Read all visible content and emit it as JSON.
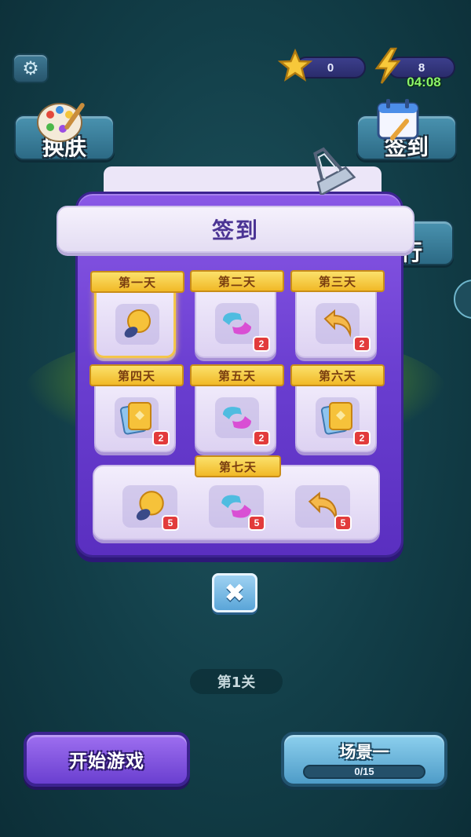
{
  "hud": {
    "stars": "0",
    "energy": "8",
    "timer": "04:08",
    "settings_icon": "gear-icon"
  },
  "side_buttons": {
    "skin": "换肤",
    "signin": "签到",
    "rank_partial": "行"
  },
  "signin_modal": {
    "title": "签到",
    "days": [
      {
        "label": "第一天",
        "reward_icon": "lightbulb-icon",
        "qty": "",
        "current": true
      },
      {
        "label": "第二天",
        "reward_icon": "swap-shapes-icon",
        "qty": "2"
      },
      {
        "label": "第三天",
        "reward_icon": "undo-arrow-icon",
        "qty": "2"
      },
      {
        "label": "第四天",
        "reward_icon": "card-icon",
        "qty": "2"
      },
      {
        "label": "第五天",
        "reward_icon": "swap-shapes-icon",
        "qty": "2"
      },
      {
        "label": "第六天",
        "reward_icon": "card-icon",
        "qty": "2"
      }
    ],
    "day7": {
      "label": "第七天",
      "rewards": [
        {
          "icon": "lightbulb-icon",
          "qty": "5"
        },
        {
          "icon": "swap-shapes-icon",
          "qty": "5"
        },
        {
          "icon": "undo-arrow-icon",
          "qty": "5"
        }
      ]
    },
    "close_icon": "close-icon"
  },
  "level": "第1关",
  "start_button": "开始游戏",
  "scene": {
    "title": "场景一",
    "progress_text": "0/15",
    "progress": 0
  },
  "colors": {
    "background": "#123e48",
    "modal_purple": "#6a3ed0",
    "ribbon_gold": "#f1b927",
    "badge_red": "#e23b3b",
    "timer_green": "#8cf56a"
  }
}
